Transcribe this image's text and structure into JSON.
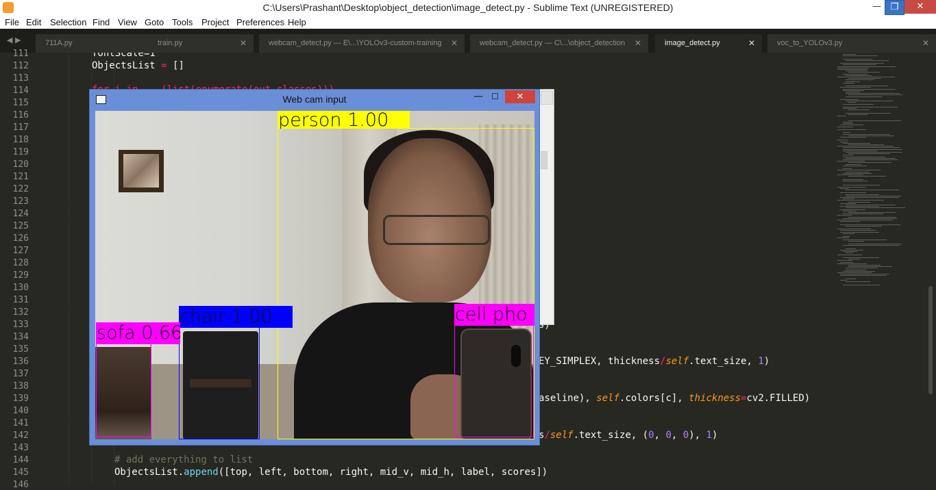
{
  "window": {
    "title": "C:\\Users\\Prashant\\Desktop\\object_detection\\image_detect.py - Sublime Text (UNREGISTERED)",
    "min_glyph": "—",
    "max_glyph": "❐",
    "close_glyph": "✕"
  },
  "menu": [
    "File",
    "Edit",
    "Selection",
    "Find",
    "View",
    "Goto",
    "Tools",
    "Project",
    "Preferences",
    "Help"
  ],
  "tab_nav": "◀ ▶",
  "tabs": [
    {
      "label": "711A.py",
      "close": "✕"
    },
    {
      "label": "train.py",
      "close": "✕"
    },
    {
      "label": "webcam_detect.py — E\\...\\YOLOv3-custom-training",
      "close": "✕"
    },
    {
      "label": "webcam_detect.py — C\\...\\object_detection",
      "close": "✕"
    },
    {
      "label": "image_detect.py",
      "close": "✕",
      "active": true
    },
    {
      "label": "voc_to_YOLOv3.py",
      "close": "✕"
    }
  ],
  "line_numbers": [
    "111",
    "112",
    "113",
    "114",
    "115",
    "116",
    "117",
    "118",
    "119",
    "120",
    "121",
    "122",
    "123",
    "124",
    "125",
    "126",
    "127",
    "128",
    "129",
    "130",
    "131",
    "132",
    "133",
    "134",
    "135",
    "136",
    "137",
    "138",
    "139",
    "140",
    "141",
    "142",
    "143",
    "144",
    "145",
    "146"
  ],
  "code": {
    "l111": "fontScale=1",
    "l112a": "ObjectsList ",
    "l112b": "=",
    "l112c": " []",
    "l114": "for i in ...(list(enumerate(out_classes)))",
    "l133": "s)",
    "l136a": "EY_SIMPLEX, thickness",
    "l136b": "/",
    "l136c": "self",
    "l136d": ".text_size, ",
    "l136e": "1",
    "l136f": ")",
    "l139a": "aseline), ",
    "l139b": "self",
    "l139c": ".colors[c], ",
    "l139d": "thickness",
    "l139e": "=",
    "l139f": "cv2.FILLED)",
    "l142a": "s",
    "l142b": "/",
    "l142c": "self",
    "l142d": ".text_size, (",
    "l142e": "0",
    "l142f": ", ",
    "l142g": "0",
    "l142h": ", ",
    "l142i": "0",
    "l142j": "), ",
    "l142k": "1",
    "l142l": ")",
    "l144": "# add everything to list",
    "l145a": "ObjectsList.",
    "l145b": "append",
    "l145c": "([top, left, bottom, right, mid_v, mid_h, label, scores])"
  },
  "webcam": {
    "title": "Web cam input",
    "min_glyph": "—",
    "max_glyph": "☐",
    "close_glyph": "✕"
  },
  "detections": [
    {
      "label": "person 1.00",
      "color": "#ffff00"
    },
    {
      "label": "chair 1.00",
      "color": "#0000ff"
    },
    {
      "label": "sofa 0.66",
      "color": "#ff00ff"
    },
    {
      "label": "cell pho",
      "color": "#ff00ff"
    }
  ],
  "colors": {
    "editor_bg": "#272822",
    "keyword": "#f92672",
    "number": "#ae81ff",
    "function": "#66d9ef",
    "param": "#fd971f",
    "comment": "#75715e"
  }
}
